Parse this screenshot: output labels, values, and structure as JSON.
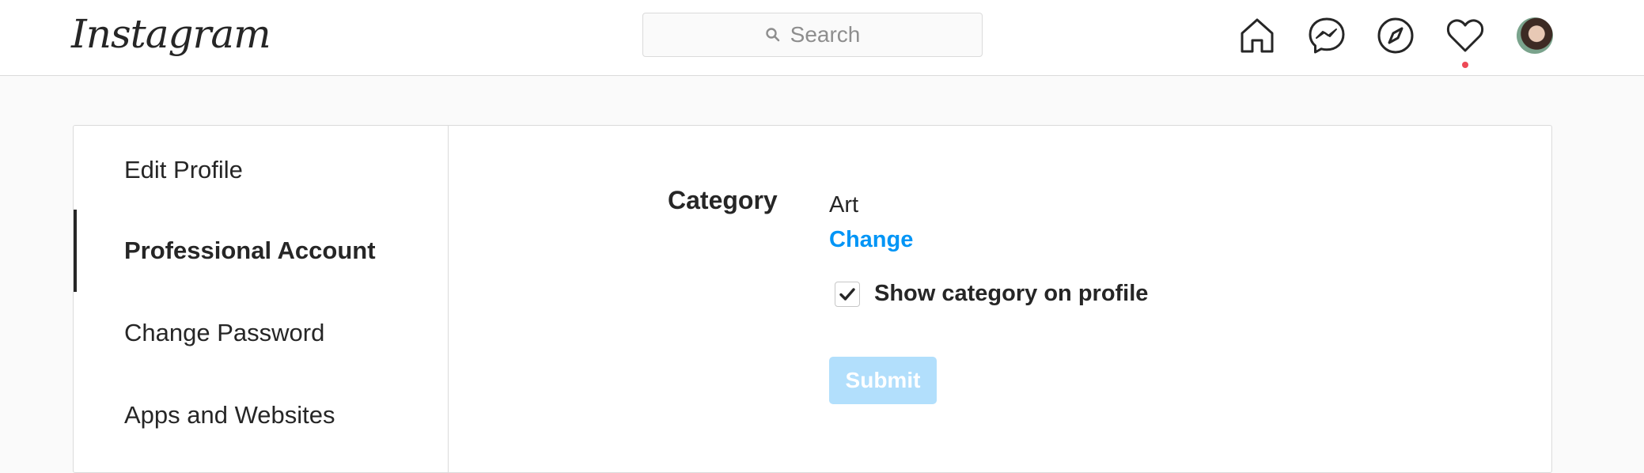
{
  "header": {
    "logo": "Instagram",
    "search": {
      "placeholder": "Search"
    }
  },
  "sidebar": {
    "items": [
      {
        "label": "Edit Profile",
        "active": false
      },
      {
        "label": "Professional Account",
        "active": true
      },
      {
        "label": "Change Password",
        "active": false
      },
      {
        "label": "Apps and Websites",
        "active": false
      }
    ]
  },
  "main": {
    "category_label": "Category",
    "category_value": "Art",
    "change_link": "Change",
    "show_category_label": "Show category on profile",
    "show_category_checked": true,
    "submit_label": "Submit"
  },
  "colors": {
    "link": "#0095f6",
    "submit_disabled": "#b2dffc",
    "notification_dot": "#ed4956"
  }
}
